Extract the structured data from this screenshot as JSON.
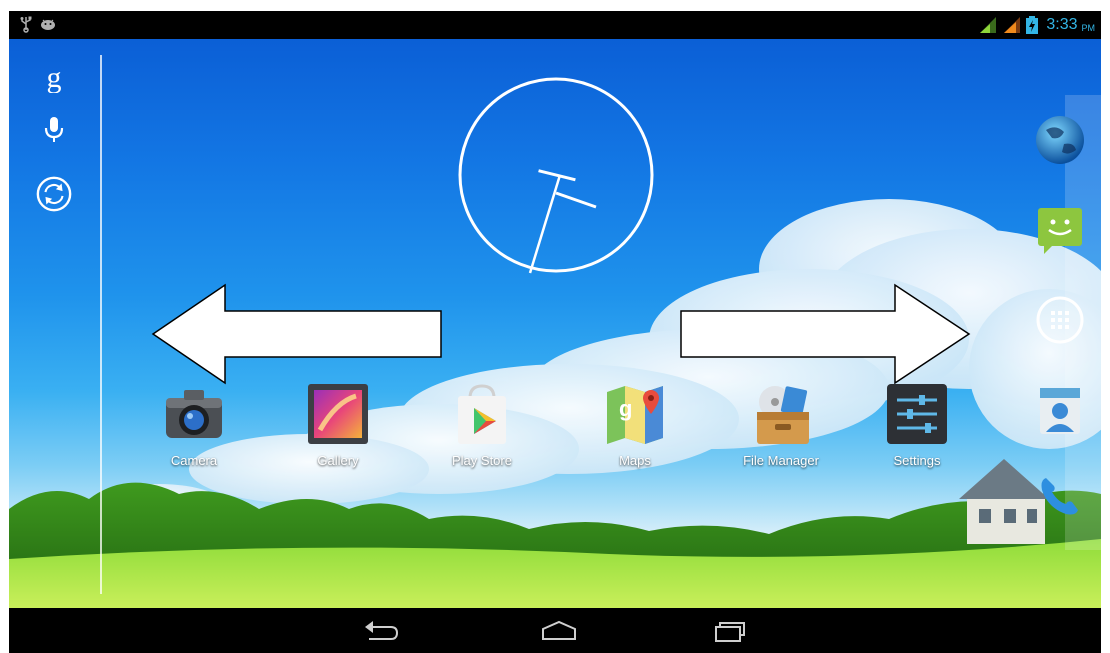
{
  "status_bar": {
    "left_icons": [
      "usb-icon",
      "android-debug-icon"
    ],
    "right_icons": [
      "signal-icon-1",
      "signal-icon-2",
      "battery-charging-icon"
    ],
    "time": "3:33",
    "ampm": "PM",
    "accent_color": "#33b5e5"
  },
  "search_rail": {
    "items": [
      "google-search-icon",
      "microphone-icon",
      "sync-icon"
    ]
  },
  "clock": {
    "type": "analog",
    "hour": 3,
    "minute": 33
  },
  "gesture_arrows": [
    "left-arrow",
    "right-arrow"
  ],
  "apps": [
    {
      "label": "Camera",
      "icon": "camera-icon"
    },
    {
      "label": "Gallery",
      "icon": "gallery-icon"
    },
    {
      "label": "Play Store",
      "icon": "play-store-icon"
    },
    {
      "label": "Maps",
      "icon": "maps-icon"
    },
    {
      "label": "File Manager",
      "icon": "file-manager-icon"
    },
    {
      "label": "Settings",
      "icon": "settings-icon"
    }
  ],
  "dock": [
    "browser-icon",
    "messaging-icon",
    "all-apps-icon",
    "contacts-icon",
    "phone-icon"
  ],
  "navigation": [
    "back-icon",
    "home-icon",
    "recent-apps-icon"
  ]
}
